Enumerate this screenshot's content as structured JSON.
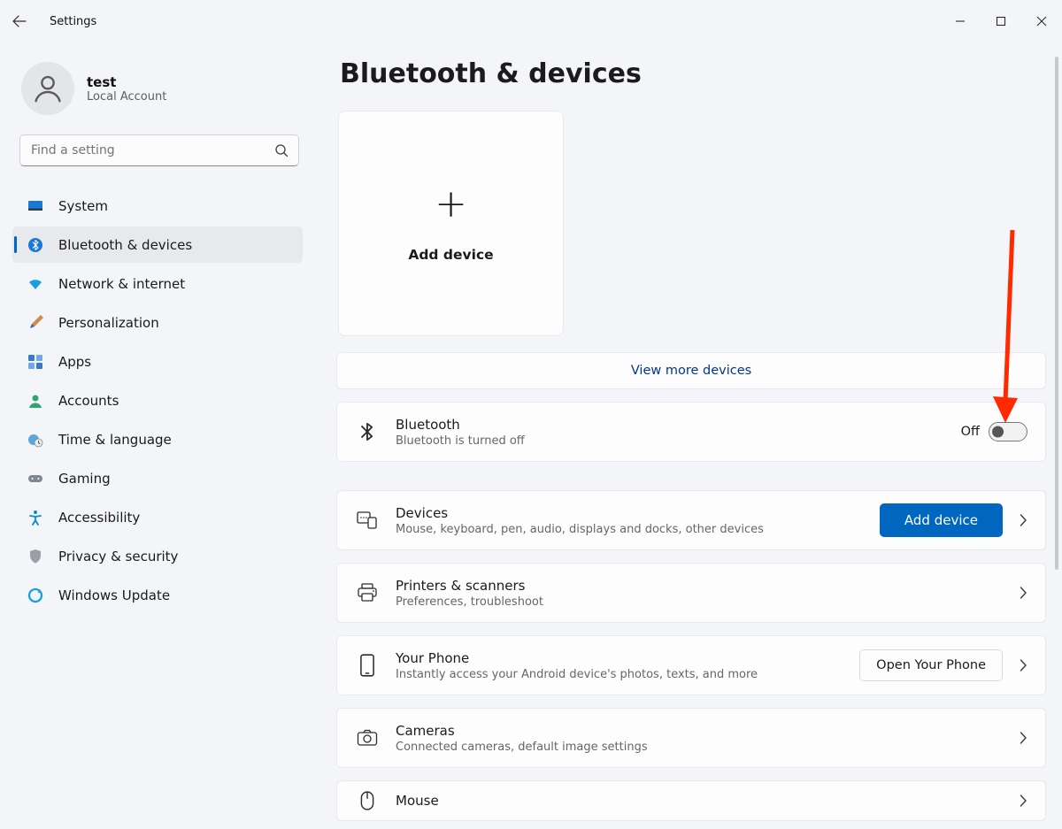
{
  "app": {
    "title": "Settings"
  },
  "account": {
    "name": "test",
    "subtitle": "Local Account"
  },
  "search": {
    "placeholder": "Find a setting"
  },
  "nav": [
    {
      "key": "system",
      "label": "System"
    },
    {
      "key": "bluetooth",
      "label": "Bluetooth & devices"
    },
    {
      "key": "network",
      "label": "Network & internet"
    },
    {
      "key": "personalization",
      "label": "Personalization"
    },
    {
      "key": "apps",
      "label": "Apps"
    },
    {
      "key": "accounts",
      "label": "Accounts"
    },
    {
      "key": "time",
      "label": "Time & language"
    },
    {
      "key": "gaming",
      "label": "Gaming"
    },
    {
      "key": "accessibility",
      "label": "Accessibility"
    },
    {
      "key": "privacy",
      "label": "Privacy & security"
    },
    {
      "key": "update",
      "label": "Windows Update"
    }
  ],
  "page": {
    "title": "Bluetooth & devices",
    "add_device_card": "Add device",
    "view_more": "View more devices",
    "bluetooth": {
      "title": "Bluetooth",
      "subtitle": "Bluetooth is turned off",
      "toggle_state": "Off"
    },
    "rows": {
      "devices": {
        "title": "Devices",
        "subtitle": "Mouse, keyboard, pen, audio, displays and docks, other devices",
        "action": "Add device"
      },
      "printers": {
        "title": "Printers & scanners",
        "subtitle": "Preferences, troubleshoot"
      },
      "yourphone": {
        "title": "Your Phone",
        "subtitle": "Instantly access your Android device's photos, texts, and more",
        "action": "Open Your Phone"
      },
      "cameras": {
        "title": "Cameras",
        "subtitle": "Connected cameras, default image settings"
      },
      "mouse": {
        "title": "Mouse"
      }
    }
  }
}
